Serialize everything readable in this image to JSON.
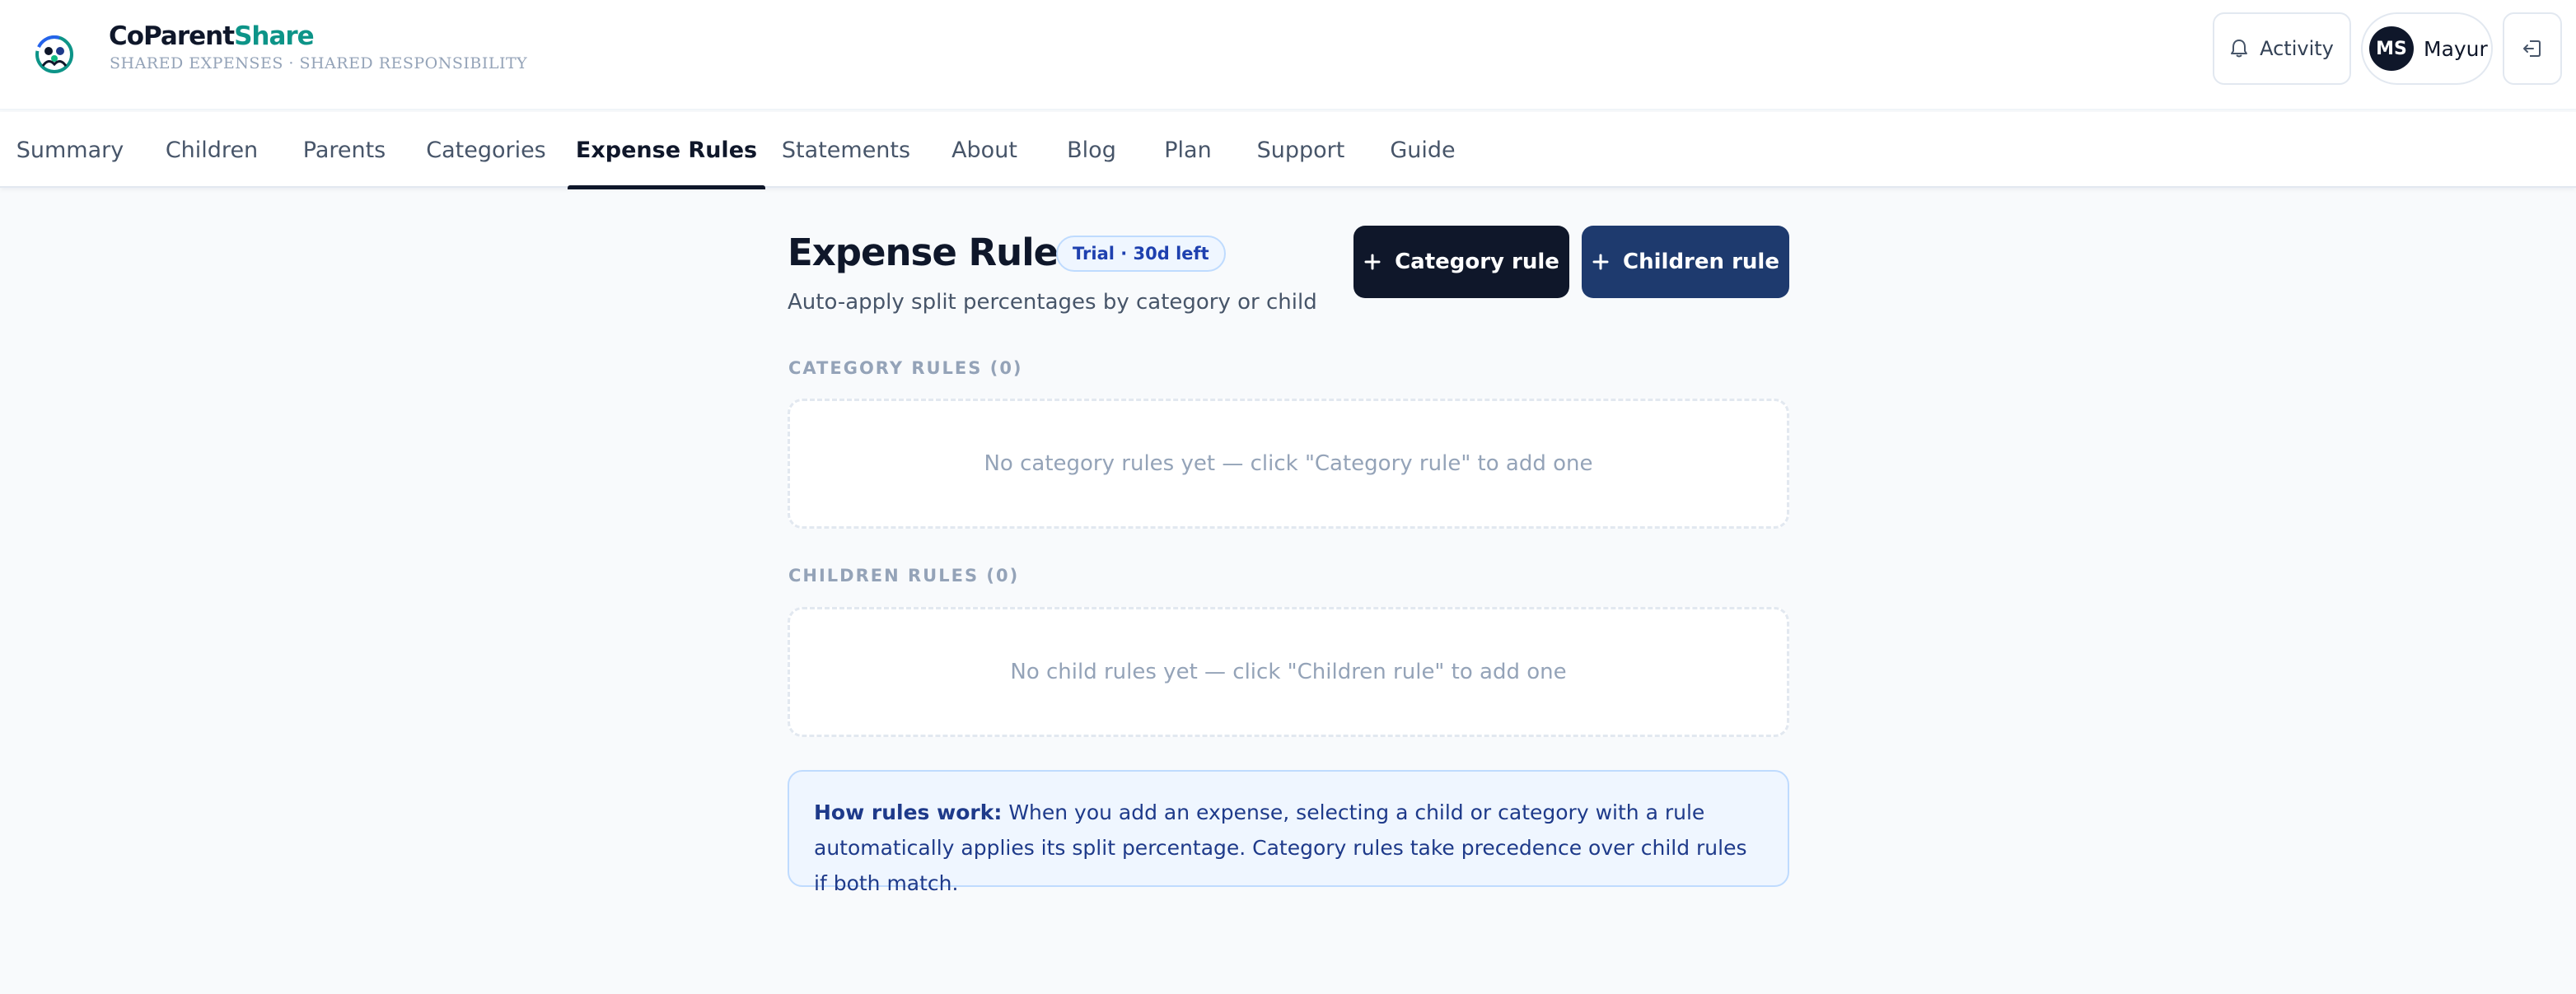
{
  "brand": {
    "name_part1": "CoParent",
    "name_part2": "Share",
    "tagline": "SHARED EXPENSES · SHARED RESPONSIBILITY",
    "accent_color": "#0d9488"
  },
  "header": {
    "activity_label": "Activity",
    "user_initials": "MS",
    "user_name": "Mayur"
  },
  "nav": {
    "tabs": [
      {
        "label": "Summary"
      },
      {
        "label": "Children"
      },
      {
        "label": "Parents"
      },
      {
        "label": "Categories"
      },
      {
        "label": "Expense Rules",
        "active": true
      },
      {
        "label": "Statements"
      },
      {
        "label": "About"
      },
      {
        "label": "Blog"
      },
      {
        "label": "Plan"
      },
      {
        "label": "Support"
      },
      {
        "label": "Guide"
      }
    ]
  },
  "page": {
    "title": "Expense Rules",
    "trial_badge": "Trial · 30d left",
    "subtitle": "Auto-apply split percentages by category or child",
    "category_rule_button": "Category rule",
    "children_rule_button": "Children rule"
  },
  "sections": {
    "category": {
      "label": "CATEGORY RULES (0)",
      "empty_text": "No category rules yet — click \"Category rule\" to add one"
    },
    "children": {
      "label": "CHILDREN RULES (0)",
      "empty_text": "No child rules yet — click \"Children rule\" to add one"
    }
  },
  "info": {
    "heading": "How rules work:",
    "text": "When you add an expense, selecting a child or category with a rule automatically applies its split percentage. Category rules take precedence over child rules if both match."
  },
  "icons": {
    "logo": "family-logo-icon",
    "activity": "bell-icon",
    "logout": "logout-icon",
    "add": "plus-icon"
  }
}
